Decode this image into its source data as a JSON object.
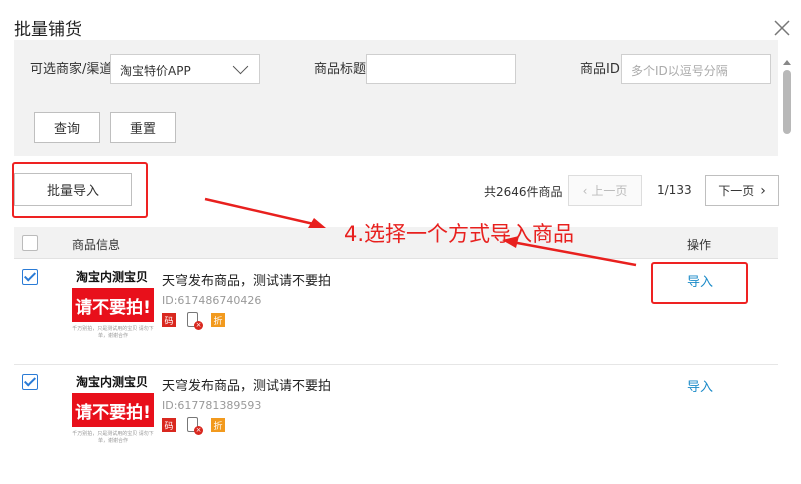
{
  "dialog": {
    "title": "批量铺货"
  },
  "filters": {
    "merchant_label": "可选商家/渠道",
    "merchant_value": "淘宝特价APP",
    "product_title_label": "商品标题",
    "product_title_value": "",
    "product_id_label": "商品ID",
    "product_id_placeholder": "多个ID以逗号分隔",
    "query_button": "查询",
    "reset_button": "重置"
  },
  "toolbar": {
    "bulk_import_button": "批量导入",
    "total_text": "共2646件商品",
    "prev_label": "上一页",
    "page_info": "1/133",
    "next_label": "下一页"
  },
  "table": {
    "headers": {
      "info": "商品信息",
      "action": "操作"
    },
    "rows": [
      {
        "thumb_title": "淘宝内测宝贝",
        "thumb_banner": "请不要拍!",
        "thumb_fine": "千万别拍，只是测试用的宝贝 请勿下单，谢谢合作",
        "title": "天穹发布商品，测试请不要拍",
        "id_text": "ID:617486740426",
        "badge_code": "码",
        "badge_discount": "折",
        "action": "导入",
        "checked": true
      },
      {
        "thumb_title": "淘宝内测宝贝",
        "thumb_banner": "请不要拍!",
        "thumb_fine": "千万别拍，只是测试用的宝贝 请勿下单，谢谢合作",
        "title": "天穹发布商品，测试请不要拍",
        "id_text": "ID:617781389593",
        "badge_code": "码",
        "badge_discount": "折",
        "action": "导入",
        "checked": true
      }
    ]
  },
  "annotation": {
    "text": "4.选择一个方式导入商品",
    "color": "#e8201e"
  },
  "colors": {
    "link": "#1a8ac8",
    "checkbox": "#2a7bd6",
    "highlight": "#e22222",
    "badge_red": "#d9281f",
    "badge_orange": "#f29a1e"
  }
}
